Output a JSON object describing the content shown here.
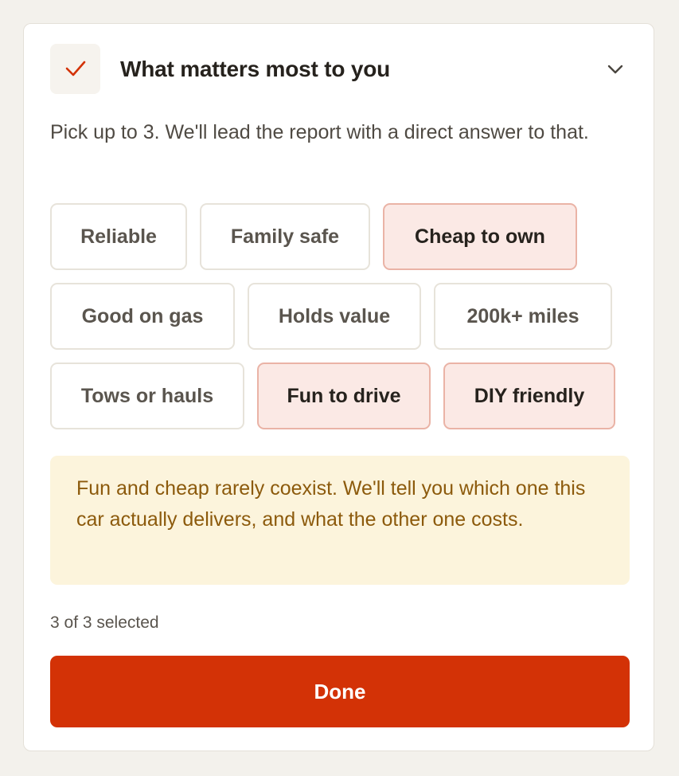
{
  "header": {
    "icon": "check-icon",
    "title": "What matters most to you",
    "toggle_icon": "chevron-down-icon"
  },
  "subtitle": "Pick up to 3. We'll lead the report with a direct answer to that.",
  "options": [
    {
      "label": "Reliable",
      "selected": false
    },
    {
      "label": "Family safe",
      "selected": false
    },
    {
      "label": "Cheap to own",
      "selected": true
    },
    {
      "label": "Good on gas",
      "selected": false
    },
    {
      "label": "Holds value",
      "selected": false
    },
    {
      "label": "200k+ miles",
      "selected": false
    },
    {
      "label": "Tows or hauls",
      "selected": false
    },
    {
      "label": "Fun to drive",
      "selected": true
    },
    {
      "label": "DIY friendly",
      "selected": true
    }
  ],
  "note": "Fun and cheap rarely coexist. We'll tell you which one this car actually delivers, and what the other one costs.",
  "selection_count": "3 of 3 selected",
  "done_label": "Done",
  "colors": {
    "accent": "#d33206",
    "selected_bg": "#fbe9e5",
    "selected_border": "#eab3a6",
    "note_bg": "#fcf4dc",
    "note_text": "#8c5a0c"
  }
}
